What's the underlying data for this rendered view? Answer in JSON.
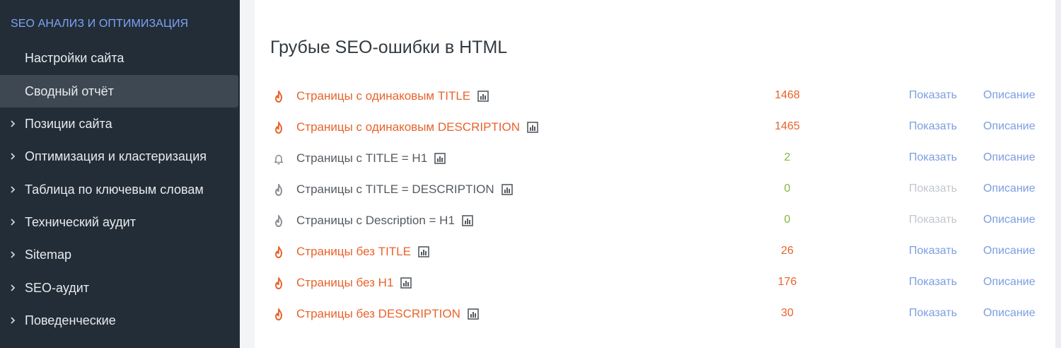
{
  "sidebar": {
    "section_title": "SEO АНАЛИЗ И ОПТИМИЗАЦИЯ",
    "items": [
      {
        "label": "Настройки сайта",
        "has_chevron": false,
        "active": false
      },
      {
        "label": "Сводный отчёт",
        "has_chevron": false,
        "active": true
      },
      {
        "label": "Позиции сайта",
        "has_chevron": true,
        "active": false
      },
      {
        "label": "Оптимизация и кластеризация",
        "has_chevron": true,
        "active": false
      },
      {
        "label": "Таблица по ключевым словам",
        "has_chevron": true,
        "active": false
      },
      {
        "label": "Технический аудит",
        "has_chevron": true,
        "active": false
      },
      {
        "label": "Sitemap",
        "has_chevron": true,
        "active": false
      },
      {
        "label": "SEO-аудит",
        "has_chevron": true,
        "active": false
      },
      {
        "label": "Поведенческие",
        "has_chevron": true,
        "active": false
      }
    ]
  },
  "main": {
    "title": "Грубые SEO-ошибки в HTML",
    "rows": [
      {
        "label": "Страницы с одинаковым TITLE",
        "count": "1468",
        "status": "error",
        "icon": "fire-icon",
        "show_label": "Показать",
        "show_enabled": true,
        "desc_label": "Описание"
      },
      {
        "label": "Страницы с одинаковым DESCRIPTION",
        "count": "1465",
        "status": "error",
        "icon": "fire-icon",
        "show_label": "Показать",
        "show_enabled": true,
        "desc_label": "Описание"
      },
      {
        "label": "Страницы с TITLE = H1",
        "count": "2",
        "status": "warning",
        "icon": "bell-icon",
        "show_label": "Показать",
        "show_enabled": true,
        "desc_label": "Описание"
      },
      {
        "label": "Страницы с TITLE = DESCRIPTION",
        "count": "0",
        "status": "ok",
        "icon": "fire-icon",
        "show_label": "Показать",
        "show_enabled": false,
        "desc_label": "Описание"
      },
      {
        "label": "Страницы с Description = H1",
        "count": "0",
        "status": "ok",
        "icon": "fire-icon",
        "show_label": "Показать",
        "show_enabled": false,
        "desc_label": "Описание"
      },
      {
        "label": "Страницы без TITLE",
        "count": "26",
        "status": "error",
        "icon": "fire-icon",
        "show_label": "Показать",
        "show_enabled": true,
        "desc_label": "Описание"
      },
      {
        "label": "Страницы без H1",
        "count": "176",
        "status": "error",
        "icon": "fire-icon",
        "show_label": "Показать",
        "show_enabled": true,
        "desc_label": "Описание"
      },
      {
        "label": "Страницы без DESCRIPTION",
        "count": "30",
        "status": "error",
        "icon": "fire-icon",
        "show_label": "Показать",
        "show_enabled": true,
        "desc_label": "Описание"
      }
    ]
  },
  "colors": {
    "sidebar_bg": "#222d37",
    "sidebar_active_bg": "#3d4852",
    "section_title": "#7fa3f5",
    "error": "#e8632b",
    "ok_count": "#8cb43e",
    "link": "#7d9ee0",
    "link_disabled": "#c2c7cd",
    "neutral_icon": "#8a9096"
  }
}
